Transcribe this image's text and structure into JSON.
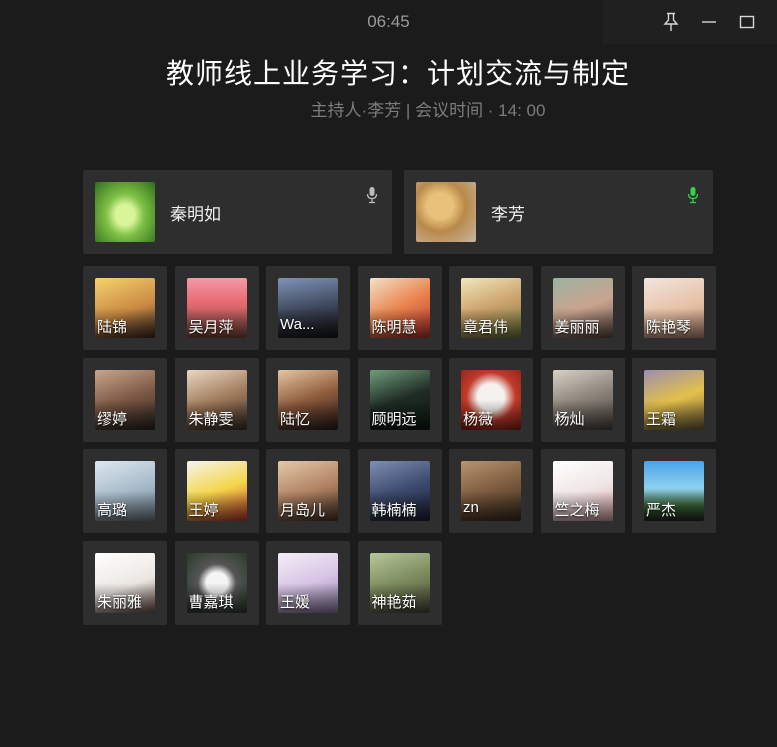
{
  "window": {
    "time": "06:45",
    "controls": {
      "pin_icon": "pin-icon",
      "minimize_icon": "minimize-icon",
      "maximize_icon": "maximize-icon"
    }
  },
  "meeting": {
    "title": "教师线上业务学习：计划交流与制定",
    "subtitle": "主持人·李芳 | 会议时间 · 14: 00"
  },
  "speakers": [
    {
      "name": "秦明如",
      "mic": "muted",
      "mic_color": "#bdbdbd",
      "avatar": "green-heart-foliage"
    },
    {
      "name": "李芳",
      "mic": "active",
      "mic_color": "#2fd44a",
      "avatar": "bread-collage"
    }
  ],
  "participants": [
    {
      "name": "陆锦",
      "avatar": "girl-yellow-background"
    },
    {
      "name": "吴月萍",
      "avatar": "cartoon-room"
    },
    {
      "name": "Wa...",
      "avatar": "person-dark-outdoors"
    },
    {
      "name": "陈明慧",
      "avatar": "anime-boy-orange"
    },
    {
      "name": "章君伟",
      "avatar": "anime-girl-green-hat"
    },
    {
      "name": "姜丽丽",
      "avatar": "girl-portrait"
    },
    {
      "name": "陈艳琴",
      "avatar": "baby-face"
    },
    {
      "name": "缪婷",
      "avatar": "two-kids"
    },
    {
      "name": "朱静雯",
      "avatar": "blonde-girl"
    },
    {
      "name": "陆忆",
      "avatar": "girl-sunset"
    },
    {
      "name": "顾明远",
      "avatar": "anime-soccer-boy"
    },
    {
      "name": "杨薇",
      "avatar": "white-cat-red"
    },
    {
      "name": "杨灿",
      "avatar": "woman-street"
    },
    {
      "name": "王霜",
      "avatar": "yellow-toy"
    },
    {
      "name": "高璐",
      "avatar": "umbrella-girl"
    },
    {
      "name": "王婷",
      "avatar": "pikachu"
    },
    {
      "name": "月岛儿",
      "avatar": "cat-closeup"
    },
    {
      "name": "韩楠楠",
      "avatar": "girl-blue-jacket"
    },
    {
      "name": "zn",
      "avatar": "child-in-room"
    },
    {
      "name": "竺之梅",
      "avatar": "cartoon-family"
    },
    {
      "name": "严杰",
      "avatar": "palm-trees-sky"
    },
    {
      "name": "朱丽雅",
      "avatar": "cartoon-girl-white"
    },
    {
      "name": "曹嘉琪",
      "avatar": "husky-dog"
    },
    {
      "name": "王媛",
      "avatar": "anime-bunny-girl"
    },
    {
      "name": "神艳茹",
      "avatar": "girls-field"
    }
  ]
}
